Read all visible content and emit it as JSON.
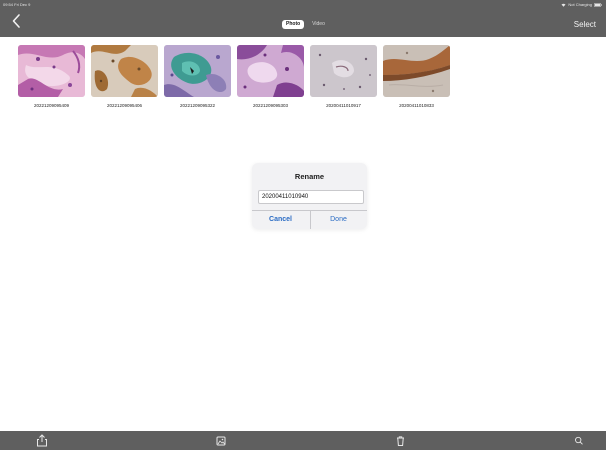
{
  "status_bar": {
    "time_date": "09:54  Fri Dec 9",
    "battery_text": "Not Charging"
  },
  "nav": {
    "back_icon": "chevron-left-icon",
    "tabs": [
      {
        "label": "Photo",
        "active": true
      },
      {
        "label": "Video",
        "active": false
      }
    ],
    "select_label": "Select"
  },
  "photos": [
    {
      "name": "20221209095409",
      "palette": "pink-he"
    },
    {
      "name": "20221209095406",
      "palette": "ihc-brown"
    },
    {
      "name": "20221209095322",
      "palette": "teal-purple"
    },
    {
      "name": "20221209095303",
      "palette": "purple-he"
    },
    {
      "name": "20200411010917",
      "palette": "pale-grey"
    },
    {
      "name": "20200411010833",
      "palette": "brown-grey"
    }
  ],
  "rename_dialog": {
    "title": "Rename",
    "input_value": "20200411010940",
    "cancel_label": "Cancel",
    "done_label": "Done"
  },
  "toolbar": {
    "icons": [
      "share-icon",
      "image-add-icon",
      "trash-icon",
      "search-icon"
    ]
  },
  "colors": {
    "bar_background": "#5f5f5f",
    "accent_blue": "#2b6cc4",
    "dialog_background": "#f2f2f4"
  }
}
